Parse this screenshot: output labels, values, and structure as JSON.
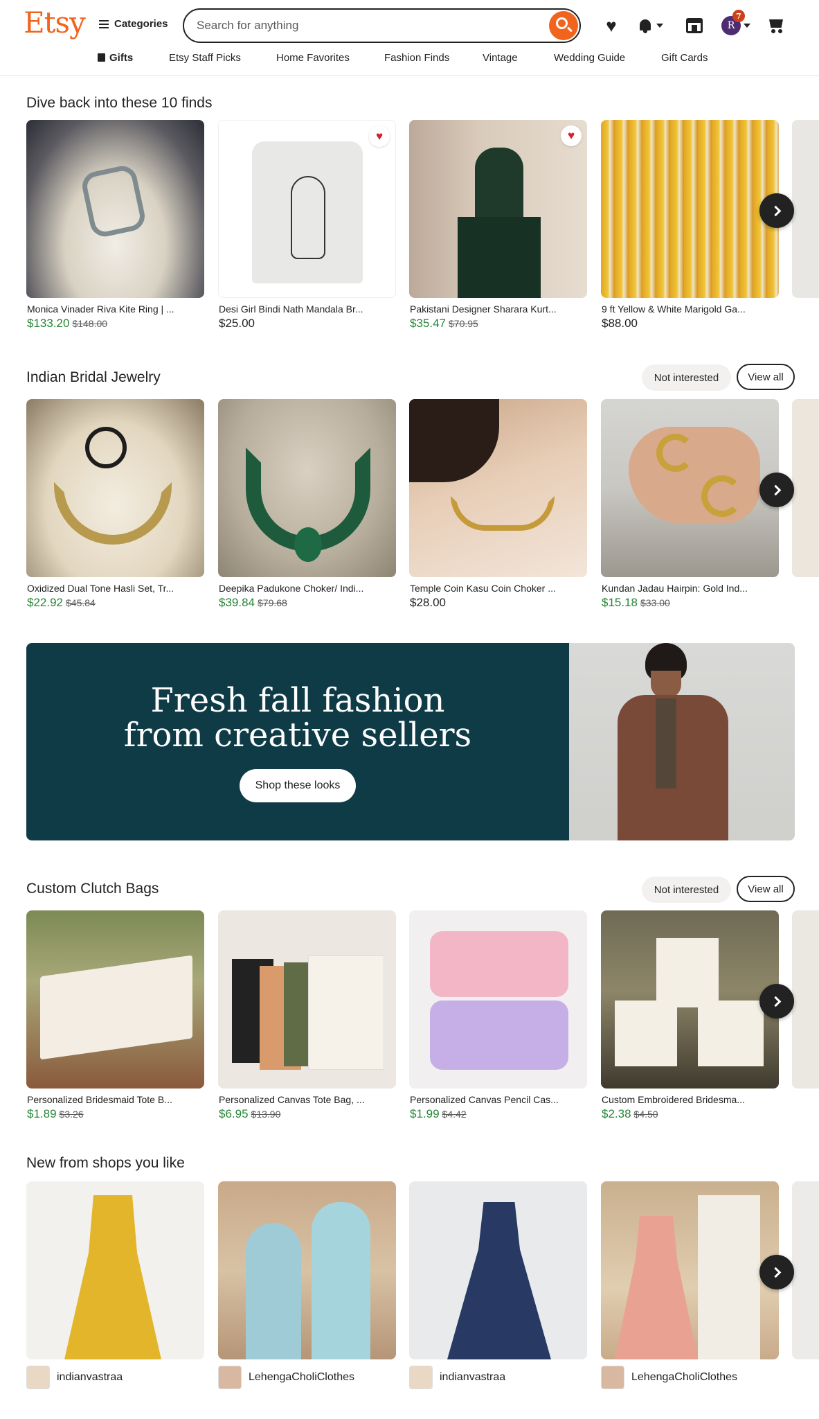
{
  "header": {
    "logo": "Etsy",
    "categories_label": "Categories",
    "search_placeholder": "Search for anything",
    "notification_count": "7",
    "avatar_initial": "R",
    "nav": [
      "Gifts",
      "Etsy Staff Picks",
      "Home Favorites",
      "Fashion Finds",
      "Vintage",
      "Wedding Guide",
      "Gift Cards"
    ]
  },
  "sections": {
    "recent": {
      "title": "Dive back into these 10 finds",
      "items": [
        {
          "title": "Monica Vinader Riva Kite Ring | ...",
          "price": "$133.20",
          "was": "$148.00"
        },
        {
          "title": "Desi Girl Bindi Nath Mandala Br...",
          "price": "$25.00",
          "was": ""
        },
        {
          "title": "Pakistani Designer Sharara Kurt...",
          "price": "$35.47",
          "was": "$70.95"
        },
        {
          "title": "9 ft Yellow & White Marigold Ga...",
          "price": "$88.00",
          "was": ""
        }
      ]
    },
    "bridal": {
      "title": "Indian Bridal Jewelry",
      "not_interested": "Not interested",
      "view_all": "View all",
      "items": [
        {
          "title": "Oxidized Dual Tone Hasli Set, Tr...",
          "price": "$22.92",
          "was": "$45.84"
        },
        {
          "title": "Deepika Padukone Choker/ Indi...",
          "price": "$39.84",
          "was": "$79.68"
        },
        {
          "title": "Temple Coin Kasu Coin Choker ...",
          "price": "$28.00",
          "was": ""
        },
        {
          "title": "Kundan Jadau Hairpin: Gold Ind...",
          "price": "$15.18",
          "was": "$33.00"
        }
      ]
    },
    "banner": {
      "line1": "Fresh fall fashion",
      "line2": "from creative sellers",
      "cta": "Shop these looks"
    },
    "clutch": {
      "title": "Custom Clutch Bags",
      "not_interested": "Not interested",
      "view_all": "View all",
      "items": [
        {
          "title": "Personalized Bridesmaid Tote B...",
          "price": "$1.89",
          "was": "$3.26"
        },
        {
          "title": "Personalized Canvas Tote Bag, ...",
          "price": "$6.95",
          "was": "$13.90"
        },
        {
          "title": "Personalized Canvas Pencil Cas...",
          "price": "$1.99",
          "was": "$4.42"
        },
        {
          "title": "Custom Embroidered Bridesma...",
          "price": "$2.38",
          "was": "$4.50"
        }
      ]
    },
    "shops": {
      "title": "New from shops you like",
      "items": [
        {
          "shop": "indianvastraa"
        },
        {
          "shop": "LehengaCholiClothes"
        },
        {
          "shop": "indianvastraa"
        },
        {
          "shop": "LehengaCholiClothes"
        }
      ]
    }
  },
  "colors": {
    "brand": "#f1641e",
    "sale_price": "#258635",
    "favorite": "#d71f2c",
    "banner_bg": "#0f3b47"
  }
}
